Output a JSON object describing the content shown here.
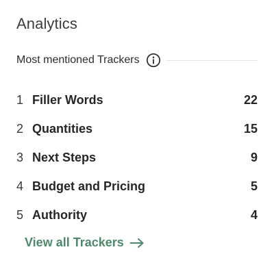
{
  "analytics": {
    "title": "Analytics",
    "section_label": "Most mentioned Trackers",
    "info_icon": "info-icon",
    "trackers": [
      {
        "rank": "1",
        "name": "Filler Words",
        "count": "22"
      },
      {
        "rank": "2",
        "name": "Quantities",
        "count": "15"
      },
      {
        "rank": "3",
        "name": "Next Steps",
        "count": "9"
      },
      {
        "rank": "4",
        "name": "Budget and Pricing",
        "count": "5"
      },
      {
        "rank": "5",
        "name": "Authority",
        "count": "4"
      }
    ],
    "view_all_label": "View all Trackers",
    "view_all_icon": "arrow-right-icon",
    "link_color": "#4e8a69"
  }
}
